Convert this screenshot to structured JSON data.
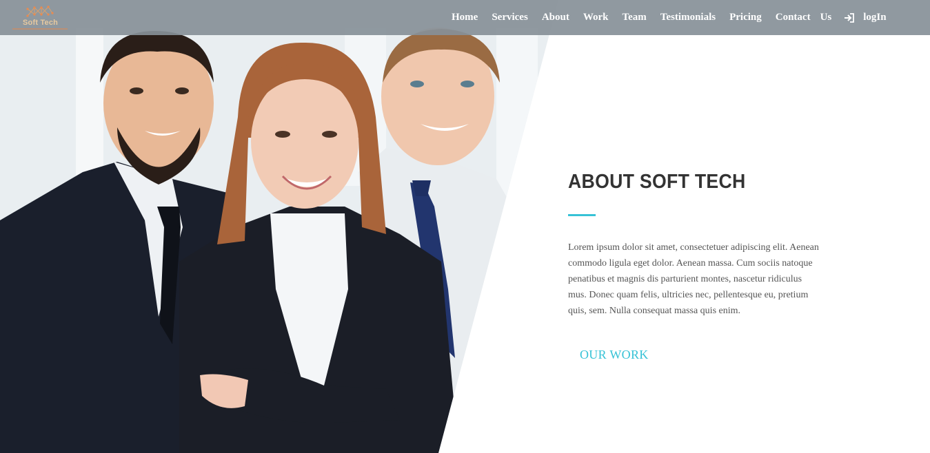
{
  "brand": {
    "name": "Soft Tech"
  },
  "nav": {
    "items": [
      "Home",
      "Services",
      "About",
      "Work",
      "Team",
      "Testimonials",
      "Pricing",
      "Contact"
    ],
    "us_label": "Us",
    "login_label": "logIn",
    "login_icon": "sign-in-icon"
  },
  "hero": {
    "photo_subject": "three smiling business people"
  },
  "about": {
    "title": "ABOUT SOFT TECH",
    "text": "Lorem ipsum dolor sit amet, consectetuer adipiscing elit. Aenean commodo ligula eget dolor. Aenean massa. Cum sociis natoque penatibus et magnis dis parturient montes, nascetur ridiculus mus. Donec quam felis, ultricies nec, pellentesque eu, pretium quis, sem. Nulla consequat massa quis enim.",
    "button_label": "OUR WORK"
  },
  "colors": {
    "accent": "#36c2d6",
    "navbar": "#879098",
    "heading": "#333333"
  }
}
